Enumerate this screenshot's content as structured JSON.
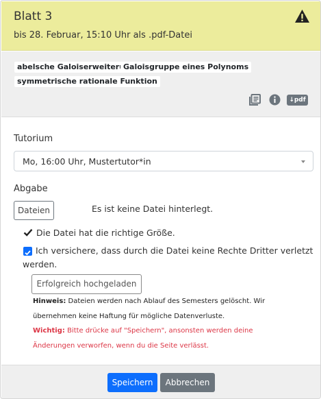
{
  "header": {
    "title": "Blatt 3",
    "deadline": "bis 28. Februar, 15:10 Uhr als .pdf-Datei",
    "warning_icon": "warning-triangle-icon"
  },
  "tags": [
    "abelsche Galoiserweiterung",
    "Galoisgruppe eines Polynoms",
    "symmetrische rationale Funktion"
  ],
  "icons": {
    "book": "library-books-icon",
    "info": "info-circle-icon",
    "pdf_label": "↓pdf"
  },
  "tutorium": {
    "label": "Tutorium",
    "selected": "Mo, 16:00 Uhr, Mustertutor*in"
  },
  "abgabe": {
    "label": "Abgabe",
    "files_button": "Dateien",
    "no_file_text": "Es ist keine Datei hinterlegt.",
    "size_ok": "Die Datei hat die richtige Größe.",
    "rights_line1": "Ich versichere, dass durch die Datei keine Rechte Dritter verletzt",
    "rights_line2": "werden.",
    "upload_button": "Erfolgreich hochgeladen",
    "hint_label": "Hinweis:",
    "hint_line1": "Dateien werden nach Ablauf des Semesters gelöscht. Wir",
    "hint_line2": "übernehmen keine Haftung für mögliche Datenverluste.",
    "important_label": "Wichtig:",
    "important_line1": "Bitte drücke auf \"Speichern\", ansonsten werden deine",
    "important_line2": "Änderungen verworfen, wenn du die Seite verlässt."
  },
  "footer": {
    "save": "Speichern",
    "cancel": "Abbrechen"
  },
  "colors": {
    "header_bg": "#ecec9c",
    "primary": "#0d6efd",
    "secondary": "#6c757d",
    "danger": "#dc3545"
  }
}
